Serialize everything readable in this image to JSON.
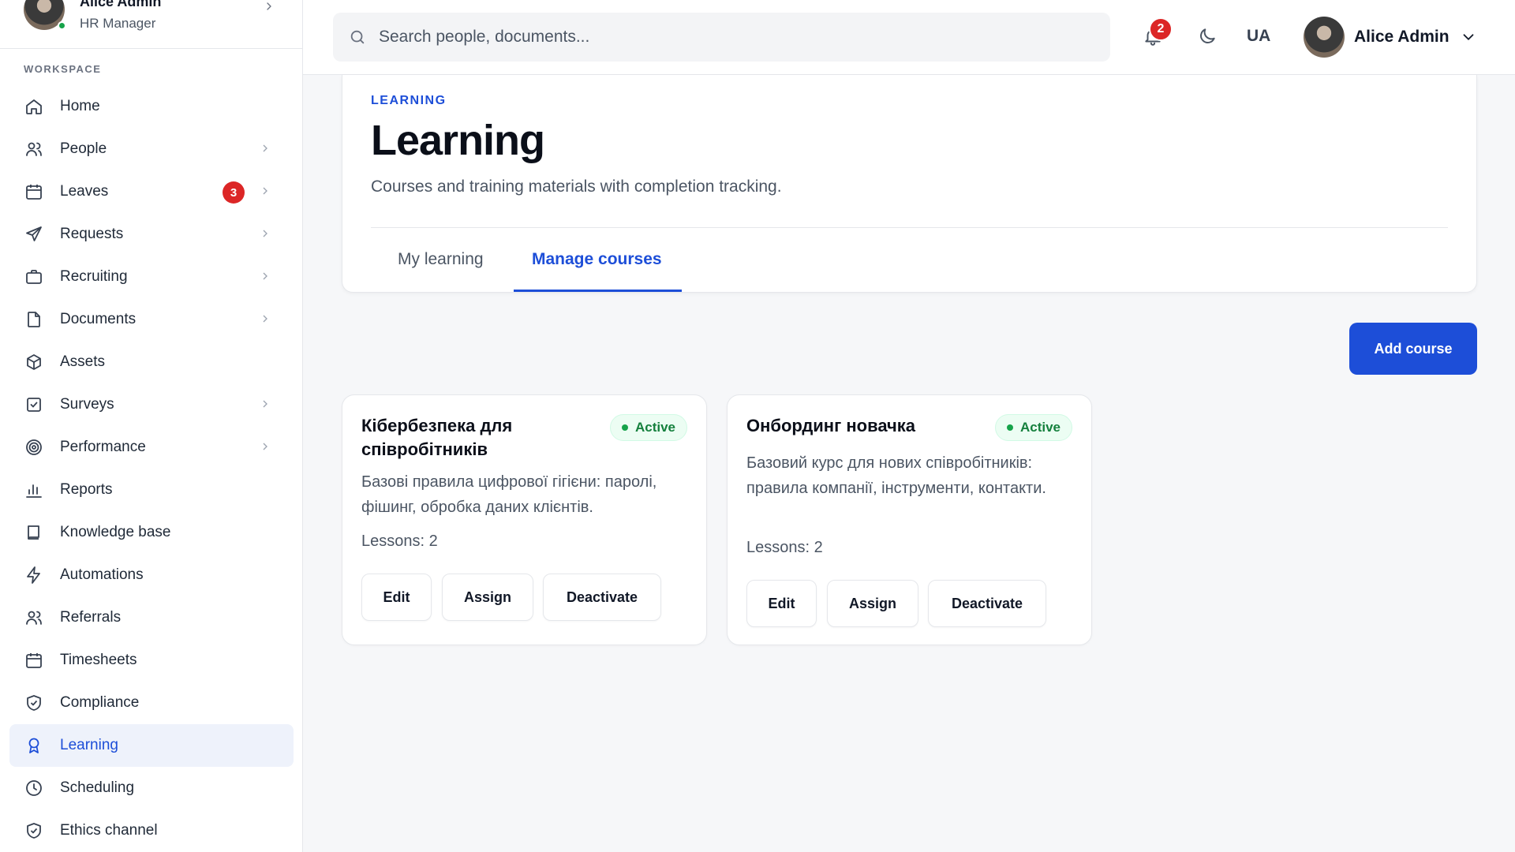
{
  "profile": {
    "name": "Alice Admin",
    "role": "HR Manager"
  },
  "sidebar": {
    "section_label": "WORKSPACE",
    "items": [
      {
        "label": "Home",
        "icon": "home-icon"
      },
      {
        "label": "People",
        "icon": "people-icon",
        "chevron": true
      },
      {
        "label": "Leaves",
        "icon": "calendar-icon",
        "chevron": true,
        "badge": "3"
      },
      {
        "label": "Requests",
        "icon": "send-icon",
        "chevron": true
      },
      {
        "label": "Recruiting",
        "icon": "briefcase-icon",
        "chevron": true
      },
      {
        "label": "Documents",
        "icon": "document-icon",
        "chevron": true
      },
      {
        "label": "Assets",
        "icon": "box-icon"
      },
      {
        "label": "Surveys",
        "icon": "checkbox-icon",
        "chevron": true
      },
      {
        "label": "Performance",
        "icon": "target-icon",
        "chevron": true
      },
      {
        "label": "Reports",
        "icon": "bar-chart-icon"
      },
      {
        "label": "Knowledge base",
        "icon": "book-icon"
      },
      {
        "label": "Automations",
        "icon": "lightning-icon"
      },
      {
        "label": "Referrals",
        "icon": "people-icon"
      },
      {
        "label": "Timesheets",
        "icon": "calendar-icon"
      },
      {
        "label": "Compliance",
        "icon": "shield-check-icon"
      },
      {
        "label": "Learning",
        "icon": "award-icon",
        "active": true
      },
      {
        "label": "Scheduling",
        "icon": "clock-icon"
      },
      {
        "label": "Ethics channel",
        "icon": "shield-check-icon"
      }
    ]
  },
  "header": {
    "search_placeholder": "Search people, documents...",
    "notifications_count": "2",
    "language": "UA",
    "user_name": "Alice Admin"
  },
  "page": {
    "eyebrow": "LEARNING",
    "title": "Learning",
    "subtitle": "Courses and training materials with completion tracking.",
    "tabs": [
      {
        "label": "My learning"
      },
      {
        "label": "Manage courses",
        "active": true
      }
    ],
    "add_course_label": "Add course"
  },
  "courses": [
    {
      "title": "Кібербезпека для співробітників",
      "status": "Active",
      "description": "Базові правила цифрової гігієни: паролі, фішинг, обробка даних клієнтів.",
      "lessons": "Lessons: 2",
      "actions": [
        "Edit",
        "Assign",
        "Deactivate"
      ]
    },
    {
      "title": "Онбординг новачка",
      "status": "Active",
      "description": "Базовий курс для нових співробітників: правила компанії, інструменти, контакти.",
      "lessons": "Lessons: 2",
      "actions": [
        "Edit",
        "Assign",
        "Deactivate"
      ]
    }
  ],
  "colors": {
    "accent": "#1d4ed8",
    "badge": "#dc2626",
    "active_status": "#15803d"
  }
}
